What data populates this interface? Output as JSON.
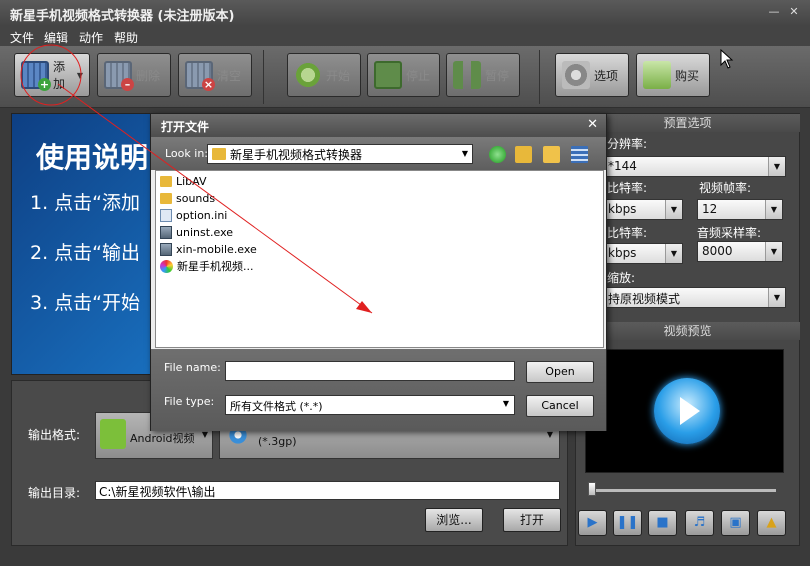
{
  "window": {
    "title": "新星手机视频格式转换器 (未注册版本)",
    "minimize_icon": "minimize-icon",
    "close_icon": "close-icon"
  },
  "menu": [
    "文件",
    "编辑",
    "动作",
    "帮助"
  ],
  "toolbar": {
    "add": "添加",
    "delete": "删除",
    "clear": "清空",
    "start": "开始",
    "stop": "停止",
    "pause": "暂停",
    "options": "选项",
    "buy": "购买"
  },
  "banner": {
    "heading": "使用说明",
    "steps": [
      "1. 点击“添加",
      "2. 点击“输出",
      "3. 点击“开始"
    ]
  },
  "output": {
    "format_label": "输出格式:",
    "device_value": "Android视频",
    "format_line2": "(*.3gp)",
    "dir_label": "输出目录:",
    "dir_value": "C:\\新星视频软件\\输出",
    "browse": "浏览...",
    "open": "打开"
  },
  "presets": {
    "title": "预置选项",
    "resolution_label": "分辨率:",
    "resolution_value": "*144",
    "video_bitrate_label": "比特率:",
    "video_bitrate_value": "kbps",
    "framerate_label": "视频帧率:",
    "framerate_value": "12",
    "audio_bitrate_label": "比特率:",
    "audio_bitrate_value": "kbps",
    "samplerate_label": "音频采样率:",
    "samplerate_value": "8000",
    "zoom_label": "缩放:",
    "zoom_value": "持原视频模式"
  },
  "preview": {
    "title": "视频预览"
  },
  "dialog": {
    "title": "打开文件",
    "look_in_label": "Look in:",
    "look_in_value": "新星手机视频格式转换器",
    "files": [
      {
        "name": "LibAV",
        "type": "folder"
      },
      {
        "name": "sounds",
        "type": "folder"
      },
      {
        "name": "option.ini",
        "type": "ini"
      },
      {
        "name": "uninst.exe",
        "type": "exe"
      },
      {
        "name": "xin-mobile.exe",
        "type": "exe"
      },
      {
        "name": "新星手机视频...",
        "type": "app"
      }
    ],
    "file_name_label": "File name:",
    "file_name_value": "",
    "file_type_label": "File type:",
    "file_type_value": "所有文件格式 (*.*)",
    "open_button": "Open",
    "cancel_button": "Cancel"
  },
  "colors": {
    "annotation": "#e02020"
  }
}
